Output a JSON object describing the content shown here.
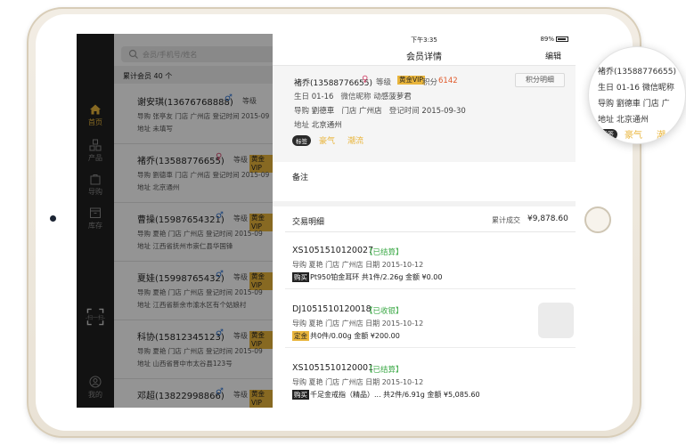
{
  "status_bar": {
    "time": "下午3:35",
    "battery": "89%"
  },
  "nav": {
    "title": "会员详情",
    "edit_label": "编辑"
  },
  "sidebar": {
    "items": [
      {
        "label": "首页",
        "icon": "home-icon",
        "active": true
      },
      {
        "label": "产品",
        "icon": "grid-icon",
        "active": false
      },
      {
        "label": "导购",
        "icon": "bag-icon",
        "active": false
      },
      {
        "label": "库存",
        "icon": "box-icon",
        "active": false
      },
      {
        "label": "-扫一扫-",
        "icon": "scan-icon",
        "active": false
      },
      {
        "label": "我的",
        "icon": "user-icon",
        "active": false
      }
    ]
  },
  "list": {
    "search_placeholder": "会员/手机号/姓名",
    "count_label": "累计会员 40 个",
    "members": [
      {
        "name": "谢安琪(13676768888)",
        "gender": "♂",
        "grade_label": "等级",
        "line1": "导购 张亭友   门店 广州店   登记时间 2015-09",
        "line2": "地址 未填写"
      },
      {
        "name": "褚乔(13588776655)",
        "gender": "♀",
        "grade_label": "等级",
        "vip": "黄金VIP",
        "line1": "导购 劉德車   门店 广州店   登记时间 2015-09",
        "line2": "地址 北京通州"
      },
      {
        "name": "曹操(15987654321)",
        "gender": "♂",
        "grade_label": "等级",
        "vip": "黄金VIP",
        "line1": "导购 夏艳   门店 广州店   登记时间 2015-09",
        "line2": "地址 江西省抚州市崇仁县华国锋"
      },
      {
        "name": "夏娃(15998765432)",
        "gender": "♂",
        "grade_label": "等级",
        "vip": "黄金VIP",
        "line1": "导购 夏艳   门店 广州店   登记时间 2015-09",
        "line2": "地址 江西省新余市渝水区有个姑娘村"
      },
      {
        "name": "科协(15812345123)",
        "gender": "♂",
        "grade_label": "等级",
        "vip": "黄金VIP",
        "line1": "导购 夏艳   门店 广州店   登记时间 2015-09",
        "line2": "地址 山西省晋中市太谷县123号"
      },
      {
        "name": "邓超(13822998866)",
        "gender": "♂",
        "grade_label": "等级",
        "vip": "黄金VIP",
        "line1": "",
        "line2": ""
      }
    ]
  },
  "detail": {
    "name": "褚乔(13588776655)",
    "gender": "♀",
    "grade_label": "等级",
    "vip": "黄金VIP",
    "points_label": "积分",
    "points": "6142",
    "points_button": "积分明细",
    "birthday_label": "生日",
    "birthday": "01-16",
    "wechat_label": "微信昵称",
    "wechat": "动感菠萝君",
    "guide_label": "导购",
    "guide": "劉德車",
    "store_label": "门店",
    "store": "广州店",
    "register_label": "登记时间",
    "register": "2015-09-30",
    "address_label": "地址",
    "address": "北京通州",
    "tag_label": "标签",
    "tags": [
      "豪气",
      "潮流"
    ],
    "remark_label": "备注",
    "tx_title": "交易明细",
    "tx_total_label": "累计成交",
    "tx_total": "¥9,878.60",
    "transactions": [
      {
        "id": "XS1051510120027",
        "status": "【已结算】",
        "meta": "导购 夏艳    门店 广州店    日期 2015-10-12",
        "kind": "购买",
        "desc": "Pt950铂金耳环   共1件/2.26g   金额  ¥0.00",
        "kind_class": "buy"
      },
      {
        "id": "DJ1051510120018",
        "status": "【已收银】",
        "meta": "导购 夏艳    门店 广州店    日期 2015-10-12",
        "kind": "定金",
        "desc": "共0件/0.00g   金额  ¥200.00",
        "kind_class": "deposit"
      },
      {
        "id": "XS1051510120001",
        "status": "【已结算】",
        "meta": "导购 夏艳    门店 广州店    日期 2015-10-12",
        "kind": "购买",
        "desc": "千足金戒指（精品）...  共2件/6.91g   金额  ¥5,085.60",
        "kind_class": "buy"
      }
    ]
  },
  "magnifier": {
    "name": "褚乔(13588776655)",
    "line1": "生日 01-16   微信昵称",
    "line2": "导购 劉德車   门店 广",
    "line3": "地址 北京通州",
    "tag_label": "标签",
    "tags": [
      "豪气",
      "潮"
    ]
  },
  "colors": {
    "accent": "#e9b53c",
    "points": "#e05a2b",
    "status_green": "#3aa845",
    "sidebar_bg": "#1f1f1f"
  }
}
